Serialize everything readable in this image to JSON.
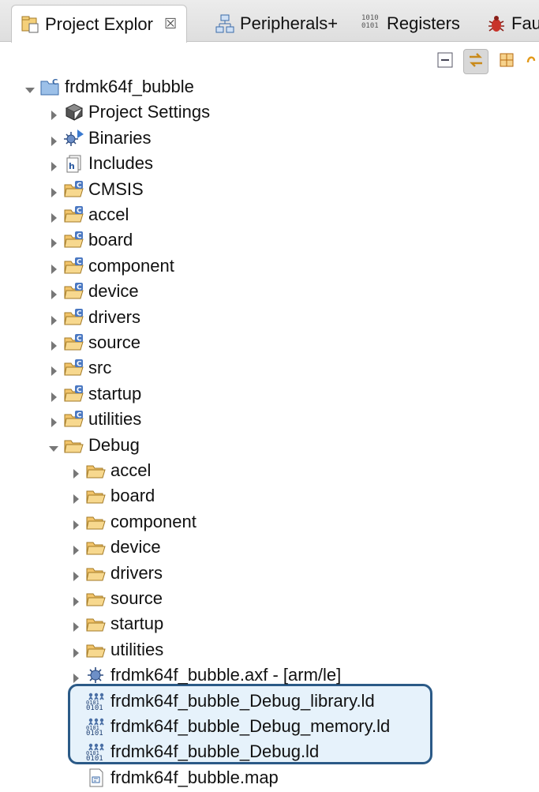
{
  "tabs": [
    {
      "label": "Project Explor",
      "close": "☒",
      "icon": "project-explorer-icon",
      "active": true
    },
    {
      "label": "Peripherals+",
      "icon": "peripherals-icon",
      "active": false
    },
    {
      "label": "Registers",
      "icon": "registers-icon",
      "active": false
    },
    {
      "label": "Fau",
      "icon": "fault-icon",
      "active": false
    }
  ],
  "toolbar": {
    "buttons": [
      "collapse-all-icon",
      "link-with-editor-icon",
      "grid-icon",
      "sync-icon"
    ]
  },
  "tree": {
    "project": "frdmk64f_bubble",
    "top_items": [
      {
        "label": "Project Settings",
        "icon": "settings-book-icon"
      },
      {
        "label": "Binaries",
        "icon": "binaries-icon"
      },
      {
        "label": "Includes",
        "icon": "includes-icon"
      },
      {
        "label": "CMSIS",
        "icon": "source-folder-icon"
      },
      {
        "label": "accel",
        "icon": "source-folder-icon"
      },
      {
        "label": "board",
        "icon": "source-folder-icon"
      },
      {
        "label": "component",
        "icon": "source-folder-icon"
      },
      {
        "label": "device",
        "icon": "source-folder-icon"
      },
      {
        "label": "drivers",
        "icon": "source-folder-icon"
      },
      {
        "label": "source",
        "icon": "source-folder-icon"
      },
      {
        "label": "src",
        "icon": "source-folder-icon"
      },
      {
        "label": "startup",
        "icon": "source-folder-icon"
      },
      {
        "label": "utilities",
        "icon": "source-folder-icon"
      }
    ],
    "debug_folder": "Debug",
    "debug_folders": [
      "accel",
      "board",
      "component",
      "device",
      "drivers",
      "source",
      "startup",
      "utilities"
    ],
    "debug_files": [
      {
        "label": "frdmk64f_bubble.axf - [arm/le]",
        "icon": "executable-icon"
      },
      {
        "label": "frdmk64f_bubble_Debug_library.ld",
        "icon": "linker-file-icon",
        "highlighted": true
      },
      {
        "label": "frdmk64f_bubble_Debug_memory.ld",
        "icon": "linker-file-icon",
        "highlighted": true
      },
      {
        "label": "frdmk64f_bubble_Debug.ld",
        "icon": "linker-file-icon",
        "highlighted": true
      },
      {
        "label": "frdmk64f_bubble.map",
        "icon": "map-file-icon"
      }
    ]
  },
  "colors": {
    "highlight_border": "#2b5a87",
    "folder": "#f2c46a",
    "source_badge": "#4a78c2"
  }
}
